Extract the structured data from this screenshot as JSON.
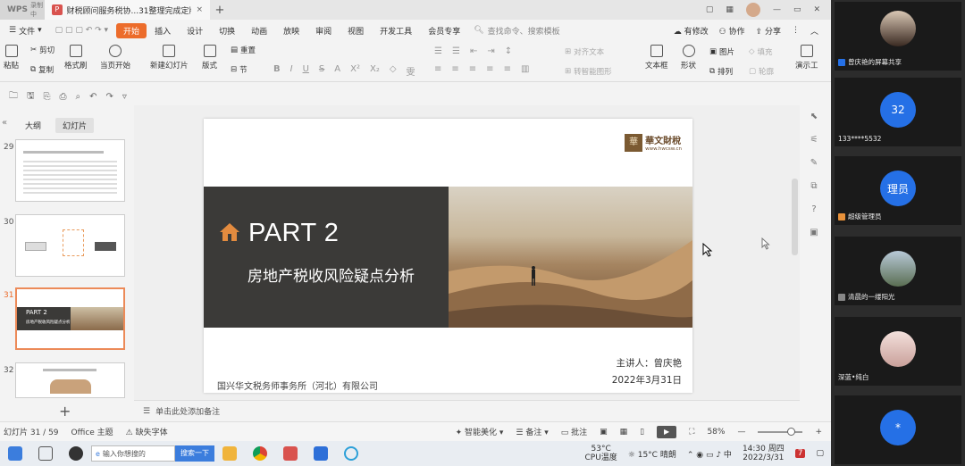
{
  "titlebar": {
    "app_label": "WPS",
    "recording": "录制中",
    "doc_title": "财税顾问服务税协...31整理完成定版",
    "close": "×",
    "new_tab": "+"
  },
  "menubar": {
    "file": "文件",
    "tabs": [
      "开始",
      "插入",
      "设计",
      "切换",
      "动画",
      "放映",
      "审阅",
      "视图",
      "开发工具",
      "会员专享"
    ],
    "active_tab": "开始",
    "search_placeholder": "查找命令、搜索模板",
    "modified": "有修改",
    "collab": "协作",
    "share": "分享"
  },
  "ribbon": {
    "paste": "粘贴",
    "cut": "剪切",
    "copy": "复制",
    "format_painter": "格式刷",
    "from_current": "当页开始",
    "new_slide": "新建幻灯片",
    "layout": "版式",
    "reset": "重置",
    "section": "节",
    "align_text": "对齐文本",
    "smart_graphic": "转智能图形",
    "textbox": "文本框",
    "shape": "形状",
    "picture": "图片",
    "fill": "填充",
    "arrange": "排列",
    "outline": "轮廓",
    "presenter": "演示工"
  },
  "left_panel": {
    "tab_outline": "大纲",
    "tab_slides": "幻灯片",
    "thumbnails": [
      {
        "num": "29"
      },
      {
        "num": "30"
      },
      {
        "num": "31",
        "selected": true,
        "part": "PART 2",
        "sub": "房地产税收风险疑点分析"
      },
      {
        "num": "32"
      }
    ],
    "add_slide": "+"
  },
  "slide": {
    "logo_cn": "華文財稅",
    "logo_url": "www.hwcsw.cn",
    "logo_seal": "華",
    "part": "PART 2",
    "subtitle": "房地产税收风险疑点分析",
    "speaker": "主讲人：曾庆艳",
    "date": "2022年3月31日",
    "company": "国兴华文税务师事务所（河北）有限公司"
  },
  "notes": {
    "placeholder": "单击此处添加备注"
  },
  "status": {
    "slide_count": "幻灯片 31 / 59",
    "theme": "Office 主题",
    "missing_font": "缺失字体",
    "smart_beautify": "智能美化",
    "notes": "备注",
    "comment": "批注",
    "zoom": "58%"
  },
  "taskbar": {
    "search_placeholder": "输入你想搜的",
    "search_button": "搜索一下",
    "cpu_temp": "53°C",
    "cpu_label": "CPU温度",
    "weather": "15°C 晴朗",
    "time": "14:30 周四",
    "date": "2022/3/31",
    "badge": "7"
  },
  "meeting": {
    "participants": [
      {
        "name": "曾庆艳的屏幕共享",
        "type": "photo"
      },
      {
        "name": "133****5532",
        "avatar_text": "32",
        "type": "blue"
      },
      {
        "name": "超级管理员",
        "avatar_text": "理员",
        "type": "blue"
      },
      {
        "name": "清晨的一缕阳光",
        "type": "photo"
      },
      {
        "name": "深蓝•纯白",
        "type": "photo"
      },
      {
        "name": "",
        "avatar_text": "*",
        "type": "blue"
      }
    ]
  },
  "colors": {
    "accent": "#ec6c2b",
    "meeting_blue": "#2570e6",
    "banner_dark": "#3b3a38"
  }
}
